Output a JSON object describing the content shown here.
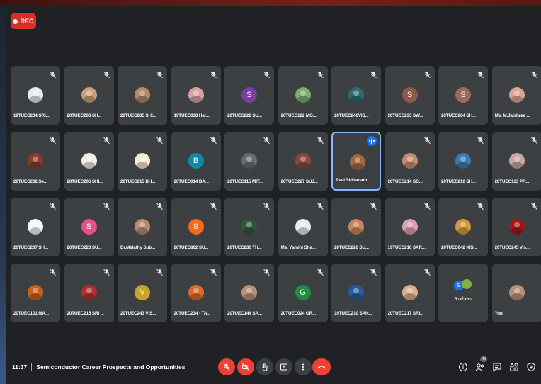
{
  "recording": {
    "label": "REC"
  },
  "rows": [
    [
      {
        "name": "19TUEC234 SRI...",
        "avatar": "#e8eaed",
        "type": "photo"
      },
      {
        "name": "20TUEC208 SH...",
        "avatar": "#c9a27b",
        "type": "photo"
      },
      {
        "name": "20TUEC205 SHI...",
        "avatar": "#b58a66",
        "type": "photo"
      },
      {
        "name": "19TUEC038 Har...",
        "avatar": "#d4a3a0",
        "type": "photo"
      },
      {
        "name": "20TUEC222 SU...",
        "avatar": "#7b3fa0",
        "type": "letter",
        "letter": "S"
      },
      {
        "name": "20TUEC122 MO...",
        "avatar": "#7fae6a",
        "type": "photo"
      },
      {
        "name": "20TUEC246VIS...",
        "avatar": "#2d6b74",
        "type": "photo"
      },
      {
        "name": "20TUEC233 SW...",
        "avatar": "#8d5a4a",
        "type": "letter",
        "letter": "S"
      },
      {
        "name": "20TUEC204 SH...",
        "avatar": "#9a6a5a",
        "type": "letter",
        "letter": "S"
      },
      {
        "name": "Ms. M.Jaishree ...",
        "avatar": "#d9a58f",
        "type": "photo"
      }
    ],
    [
      {
        "name": "20TUEC202 Se...",
        "avatar": "#8a3a2a",
        "type": "photo"
      },
      {
        "name": "20TUEC206 SHI...",
        "avatar": "#f0ece6",
        "type": "photo"
      },
      {
        "name": "20TUEC015 BH...",
        "avatar": "#f3ead2",
        "type": "photo"
      },
      {
        "name": "20TUEC014 BA...",
        "avatar": "#0d8aa8",
        "type": "letter",
        "letter": "B"
      },
      {
        "name": "20TUEC115 MIT...",
        "avatar": "#6b6b6b",
        "type": "photo"
      },
      {
        "name": "20TUEC227 SUJ...",
        "avatar": "#8a4a3a",
        "type": "photo"
      },
      {
        "name": "Ravi Siddanath",
        "avatar": "#a06a40",
        "type": "photo",
        "active": true
      },
      {
        "name": "20TUEC214 SO...",
        "avatar": "#c48a70",
        "type": "photo"
      },
      {
        "name": "20TUEC210 SH...",
        "avatar": "#3d7ab0",
        "type": "photo"
      },
      {
        "name": "20TUEC133 PR...",
        "avatar": "#c9a7a0",
        "type": "photo"
      }
    ],
    [
      {
        "name": "20TUEC207 SH...",
        "avatar": "#f5f5f5",
        "type": "photo"
      },
      {
        "name": "20TUEC223 SU...",
        "avatar": "#e8508a",
        "type": "letter",
        "letter": "S"
      },
      {
        "name": "Dr.Malathy Sub...",
        "avatar": "#b88a70",
        "type": "photo"
      },
      {
        "name": "20TUEC802 SU...",
        "avatar": "#f26a1b",
        "type": "letter",
        "letter": "S"
      },
      {
        "name": "20TUEC236 TH...",
        "avatar": "#2f5a3a",
        "type": "photo"
      },
      {
        "name": "Ms. Yamini Sha...",
        "avatar": "#eaeaea",
        "type": "photo"
      },
      {
        "name": "20TUEC226 SU...",
        "avatar": "#c8845a",
        "type": "photo"
      },
      {
        "name": "19TUEC216 SAR...",
        "avatar": "#d8a0b0",
        "type": "photo"
      },
      {
        "name": "20TUEC042 KIS...",
        "avatar": "#d39a3a",
        "type": "photo"
      },
      {
        "name": "20TUEC245 Vis...",
        "avatar": "#a01818",
        "type": "photo"
      }
    ],
    [
      {
        "name": "20TUEC101 MA...",
        "avatar": "#c8601a",
        "type": "photo"
      },
      {
        "name": "20TUEC215 SRI ...",
        "avatar": "#b0302a",
        "type": "photo"
      },
      {
        "name": "20TUEC243 VIS...",
        "avatar": "#c8a22a",
        "type": "letter",
        "letter": "V"
      },
      {
        "name": "20TUEC234 - TA...",
        "avatar": "#d86a2a",
        "type": "photo"
      },
      {
        "name": "20TUEC144 SA...",
        "avatar": "#b89078",
        "type": "photo"
      },
      {
        "name": "20TUEC024 GR...",
        "avatar": "#1e8e3e",
        "type": "letter",
        "letter": "G"
      },
      {
        "name": "19TUEC210 SAN...",
        "avatar": "#2a5aa0",
        "type": "photo"
      },
      {
        "name": "20TUEC217 SRI...",
        "avatar": "#d8b090",
        "type": "photo"
      },
      {
        "name": "9 others",
        "avatar": "#1a73e8",
        "type": "others"
      },
      {
        "name": "You",
        "avatar": "#b89078",
        "type": "photo"
      }
    ]
  ],
  "bottom_bar": {
    "time": "11:37",
    "meeting_title": "Semiconductor Career Prospects and Opportunities",
    "participant_count": "48"
  }
}
